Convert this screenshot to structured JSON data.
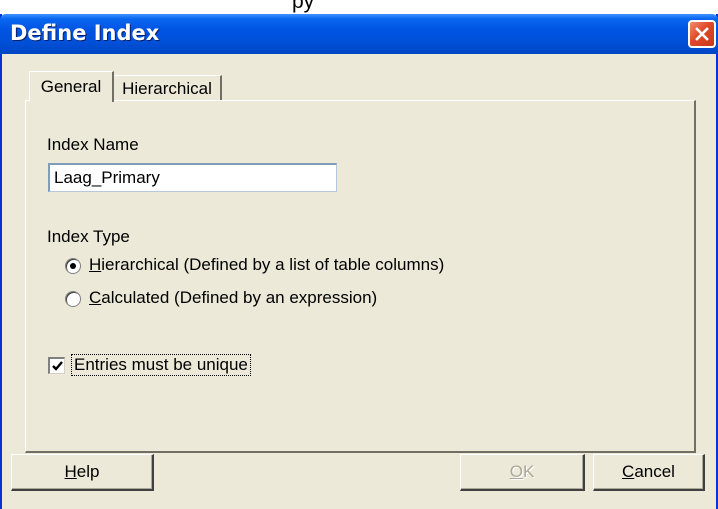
{
  "background_caption": "py",
  "window": {
    "title": "Define Index",
    "close_icon": "close-icon"
  },
  "tabs": [
    {
      "label": "General",
      "active": true
    },
    {
      "label": "Hierarchical",
      "active": false
    }
  ],
  "index_name": {
    "label": "Index Name",
    "value": "Laag_Primary"
  },
  "index_type": {
    "label": "Index Type",
    "options": [
      {
        "mnemonic": "H",
        "rest": "ierarchical (Defined by a list of table columns)",
        "selected": true
      },
      {
        "mnemonic": "C",
        "rest": "alculated (Defined by an expression)",
        "selected": false
      }
    ]
  },
  "unique": {
    "label": "Entries must be unique",
    "checked": true
  },
  "buttons": {
    "help": {
      "mnemonic": "H",
      "rest": "elp"
    },
    "ok": {
      "mnemonic": "O",
      "rest": "K",
      "enabled": false
    },
    "cancel": {
      "mnemonic": "C",
      "rest": "ancel"
    }
  },
  "colors": {
    "titlebar": "#0054e3",
    "dialog_bg": "#ece9d8",
    "close_button": "#e0492a"
  }
}
